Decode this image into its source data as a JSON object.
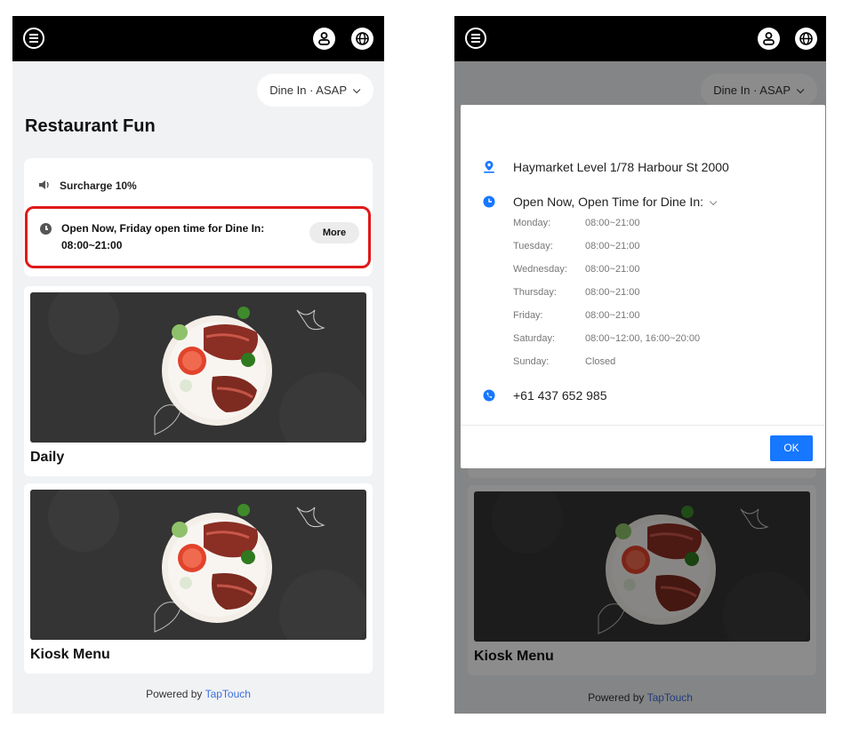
{
  "screens": {
    "left": {
      "order_pill": "Dine In · ASAP",
      "store_name": "Restaurant Fun",
      "surcharge": "Surcharge 10%",
      "open_hours_text": "Open Now, Friday open time for Dine In: 08:00~21:00",
      "more_label": "More",
      "menus": [
        "Daily",
        "Kiosk Menu"
      ],
      "footer": {
        "prefix": "Powered by",
        "brand": "TapTouch"
      }
    },
    "right": {
      "order_pill": "Dine In · ASAP",
      "menus": [
        "Kiosk Menu"
      ],
      "footer": {
        "prefix": "Powered by",
        "brand": "TapTouch"
      },
      "dialog": {
        "address": "Haymarket Level 1/78 Harbour St 2000",
        "open_status": "Open Now, Open Time for Dine In:",
        "hours": [
          {
            "day": "Monday:",
            "time": "08:00~21:00"
          },
          {
            "day": "Tuesday:",
            "time": "08:00~21:00"
          },
          {
            "day": "Wednesday:",
            "time": "08:00~21:00"
          },
          {
            "day": "Thursday:",
            "time": "08:00~21:00"
          },
          {
            "day": "Friday:",
            "time": "08:00~21:00"
          },
          {
            "day": "Saturday:",
            "time": "08:00~12:00, 16:00~20:00"
          },
          {
            "day": "Sunday:",
            "time": "Closed"
          }
        ],
        "phone": "+61 437 652 985",
        "ok_label": "OK"
      }
    }
  },
  "colors": {
    "topbar": "#000000",
    "page_bg": "#f1f2f4",
    "highlight_border": "#e01919",
    "accent_blue": "#1677ff",
    "brand_link": "#3b6fe0"
  },
  "icons": {
    "menu": "menu-icon",
    "user": "user-icon",
    "globe": "globe-icon",
    "speaker": "speaker-icon",
    "clock": "clock-icon",
    "location": "location-pin-icon",
    "phone": "phone-icon"
  }
}
